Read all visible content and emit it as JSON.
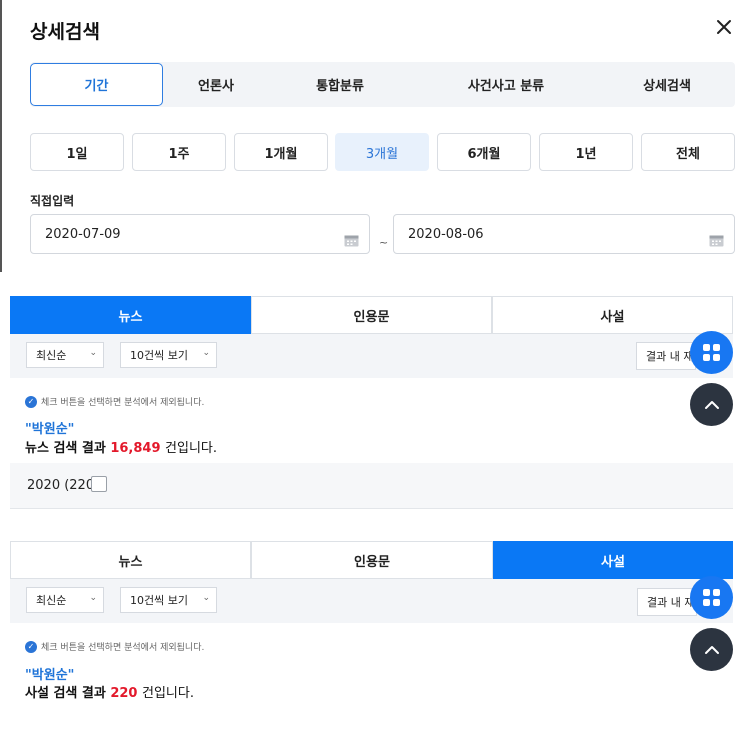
{
  "modal": {
    "title": "상세검색",
    "close_icon": "close-icon",
    "tabs": [
      {
        "label": "기간",
        "active": true
      },
      {
        "label": "언론사",
        "active": false
      },
      {
        "label": "통합분류",
        "active": false
      },
      {
        "label": "사건사고 분류",
        "active": false
      },
      {
        "label": "상세검색",
        "active": false
      }
    ],
    "periods": [
      {
        "label": "1일",
        "active": false
      },
      {
        "label": "1주",
        "active": false
      },
      {
        "label": "1개월",
        "active": false
      },
      {
        "label": "3개월",
        "active": true
      },
      {
        "label": "6개월",
        "active": false
      },
      {
        "label": "1년",
        "active": false
      },
      {
        "label": "전체",
        "active": false
      }
    ],
    "direct_input_label": "직접입력",
    "date_from": "2020-07-09",
    "date_separator": "~",
    "date_to": "2020-08-06",
    "calendar_icon": "calendar-icon"
  },
  "section1": {
    "tabs": [
      {
        "label": "뉴스",
        "active": true
      },
      {
        "label": "인용문",
        "active": false
      },
      {
        "label": "사설",
        "active": false
      }
    ],
    "sort_select": "최신순",
    "page_size_select": "10건씩 보기",
    "result_search_button": "결과 내 재",
    "notice": "체크 버튼을 선택하면 분석에서 제외됩니다.",
    "keyword": "\"박원순\"",
    "summary_prefix": "뉴스 검색 결과",
    "summary_count": "16,849",
    "summary_suffix": "건입니다.",
    "year_label": "2020 (220)"
  },
  "section2": {
    "tabs": [
      {
        "label": "뉴스",
        "active": false
      },
      {
        "label": "인용문",
        "active": false
      },
      {
        "label": "사설",
        "active": true
      }
    ],
    "sort_select": "최신순",
    "page_size_select": "10건씩 보기",
    "result_search_button": "결과 내 재",
    "notice": "체크 버튼을 선택하면 분석에서 제외됩니다.",
    "keyword": "\"박원순\"",
    "summary_prefix": "사설 검색 결과",
    "summary_count": "220",
    "summary_suffix": "건입니다."
  },
  "colors": {
    "accent": "#0a78f5",
    "active_tab_border": "#2f7de1",
    "count_red": "#e3192b",
    "fab_dark": "#2c3440"
  },
  "icons": {
    "menu_fab": "grid-icon",
    "scroll_top_fab": "chevron-up-icon",
    "select_chevron": "chevron-down-icon",
    "notice_check": "check-circle-icon"
  }
}
